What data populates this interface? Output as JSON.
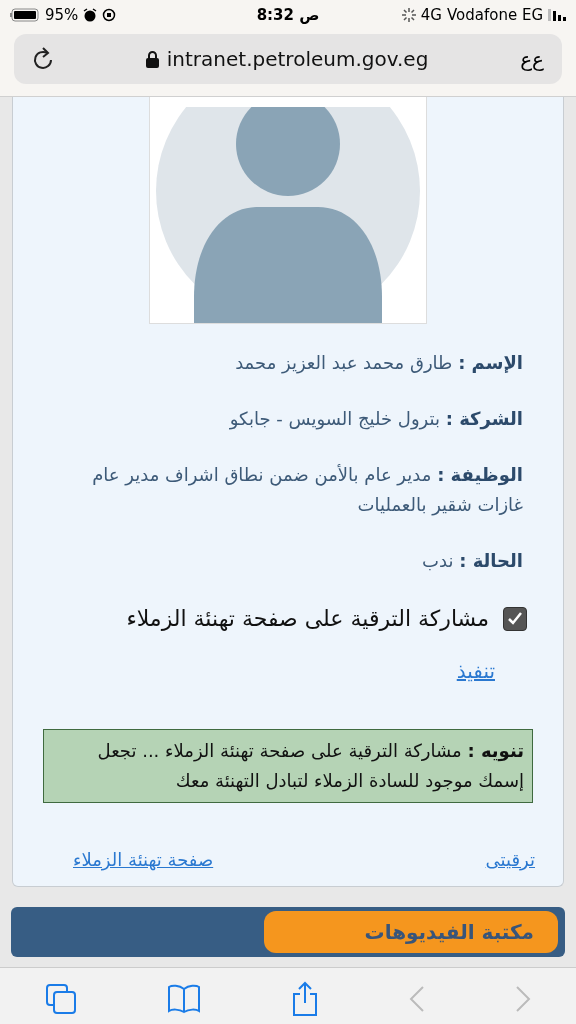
{
  "status_bar": {
    "battery": "95%",
    "time": "8:32 ص",
    "network": "4G",
    "carrier": "Vodafone EG"
  },
  "address_bar": {
    "url": "intranet.petroleum.gov.eg",
    "text_size": "ﻉﻉ"
  },
  "profile": {
    "fields": [
      {
        "text": "**الإسم :** طارق محمد عبد العزيز محمد"
      },
      {
        "text": "**الشركة :** بترول خليج السويس - جابكو"
      },
      {
        "text": "**الوظيفة :** مدير عام بالأمن ضمن نطاق اشراف مدير عام غازات شقير بالعمليات"
      },
      {
        "text": "**الحالة :** ندب"
      }
    ],
    "share_checkbox": {
      "label": "مشاركة الترقية على صفحة تهنئة الزملاء",
      "checked": true
    },
    "submit_link": "تنفيذ",
    "notice": "**تنويه :** مشاركة الترقية على صفحة تهنئة الزملاء ... تجعل إسمك موجود للسادة الزملاء لتبادل التهنئة معك",
    "links": [
      "ترقيتى",
      "صفحة تهنئة الزملاء"
    ]
  },
  "video_library": {
    "label": "مكتبة الفيديوهات"
  }
}
